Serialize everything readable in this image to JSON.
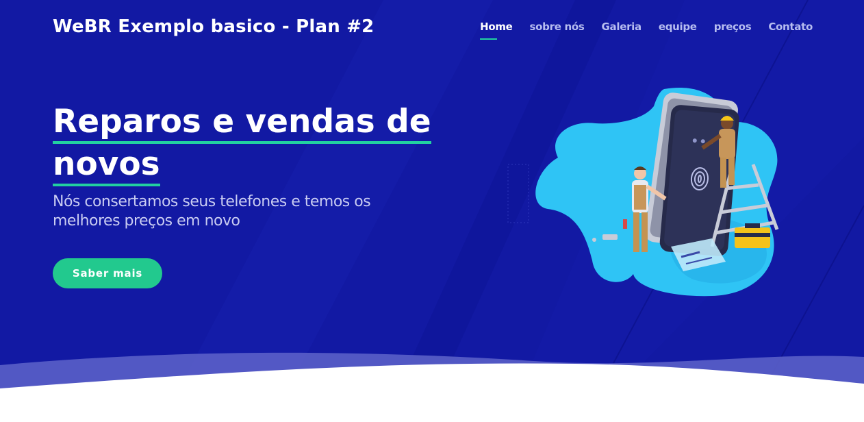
{
  "header": {
    "brand": "WeBR Exemplo basico - Plan #2",
    "nav": [
      {
        "label": "Home",
        "active": true
      },
      {
        "label": "sobre nós",
        "active": false
      },
      {
        "label": "Galeria",
        "active": false
      },
      {
        "label": "equipe",
        "active": false
      },
      {
        "label": "preços",
        "active": false
      },
      {
        "label": "Contato",
        "active": false
      }
    ]
  },
  "hero": {
    "title_line1": "Reparos e vendas de",
    "title_line2": "novos",
    "subtitle": "Nós consertamos seus telefones e temos os melhores preços em novo",
    "cta_label": "Saber mais"
  },
  "colors": {
    "background": "#1219a3",
    "accent": "#22d1a0",
    "button": "#22c98e",
    "wave": "#5a5fc8",
    "blob": "#2fc4f5"
  },
  "illustration": {
    "icon": "phone-repair-illustration"
  }
}
